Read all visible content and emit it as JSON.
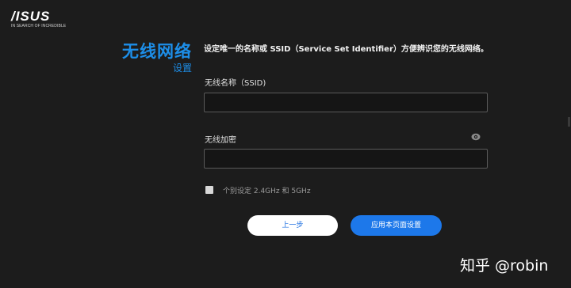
{
  "logo": {
    "brand": "/ISUS",
    "tagline": "IN SEARCH OF INCREDIBLE"
  },
  "header": {
    "title": "无线网络",
    "subtitle": "设置"
  },
  "description": "设定唯一的名称或 SSID（Service Set Identifier）方便辨识您的无线网络。",
  "form": {
    "ssid_label": "无线名称（SSID)",
    "ssid_value": "",
    "password_label": "无线加密",
    "password_value": "",
    "split_band_label": "个别设定 2.4GHz 和 5GHz",
    "split_band_checked": false
  },
  "buttons": {
    "back_label": "上一步",
    "apply_label": "应用本页面设置"
  },
  "watermark": "知乎 @robin",
  "colors": {
    "accent": "#1d8ee8",
    "background": "#1c1c1c",
    "apply_button": "#1d78ea"
  },
  "icons": {
    "password_toggle": "eye-icon"
  }
}
